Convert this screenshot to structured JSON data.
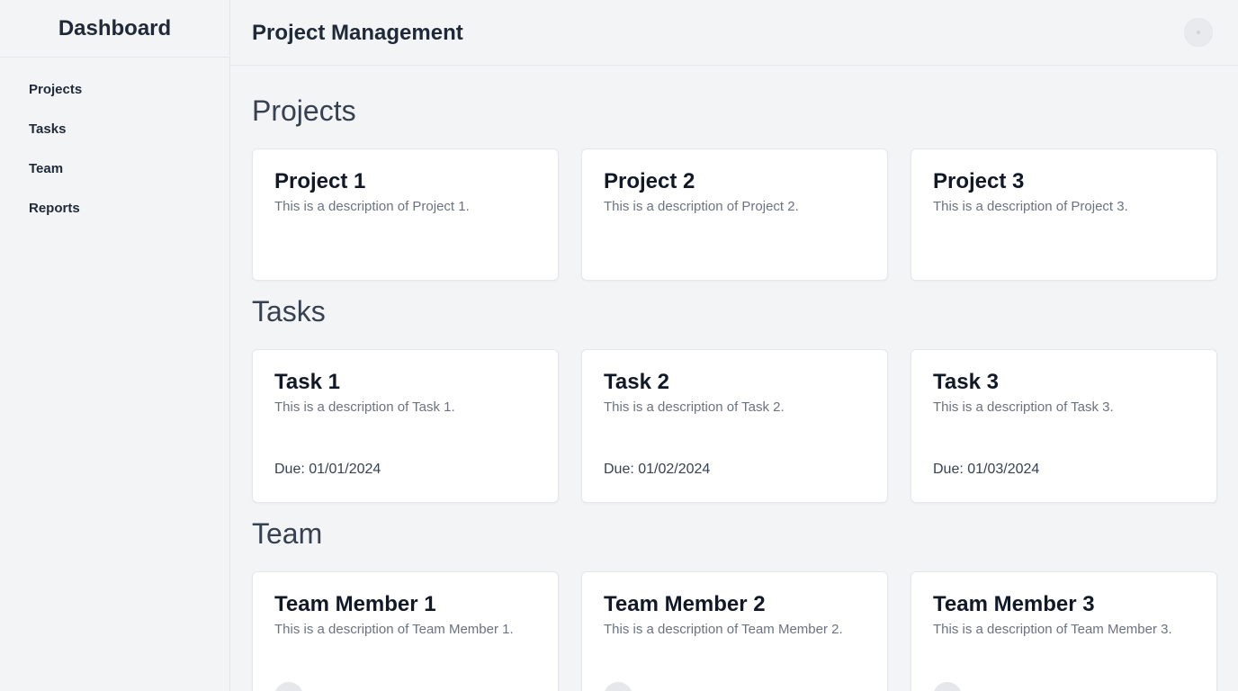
{
  "sidebar": {
    "brand": "Dashboard",
    "items": [
      {
        "label": "Projects"
      },
      {
        "label": "Tasks"
      },
      {
        "label": "Team"
      },
      {
        "label": "Reports"
      }
    ]
  },
  "header": {
    "title": "Project Management",
    "avatar_icon": "user-avatar-icon"
  },
  "sections": {
    "projects": {
      "title": "Projects",
      "cards": [
        {
          "title": "Project 1",
          "description": "This is a description of Project 1."
        },
        {
          "title": "Project 2",
          "description": "This is a description of Project 2."
        },
        {
          "title": "Project 3",
          "description": "This is a description of Project 3."
        }
      ]
    },
    "tasks": {
      "title": "Tasks",
      "cards": [
        {
          "title": "Task 1",
          "description": "This is a description of Task 1.",
          "due": "Due: 01/01/2024"
        },
        {
          "title": "Task 2",
          "description": "This is a description of Task 2.",
          "due": "Due: 01/02/2024"
        },
        {
          "title": "Task 3",
          "description": "This is a description of Task 3.",
          "due": "Due: 01/03/2024"
        }
      ]
    },
    "team": {
      "title": "Team",
      "cards": [
        {
          "title": "Team Member 1",
          "description": "This is a description of Team Member 1."
        },
        {
          "title": "Team Member 2",
          "description": "This is a description of Team Member 2."
        },
        {
          "title": "Team Member 3",
          "description": "This is a description of Team Member 3."
        }
      ]
    }
  },
  "colors": {
    "background": "#f3f4f6",
    "card": "#ffffff",
    "border": "#e5e7eb",
    "text": "#1f2937",
    "muted": "#6b7280"
  }
}
